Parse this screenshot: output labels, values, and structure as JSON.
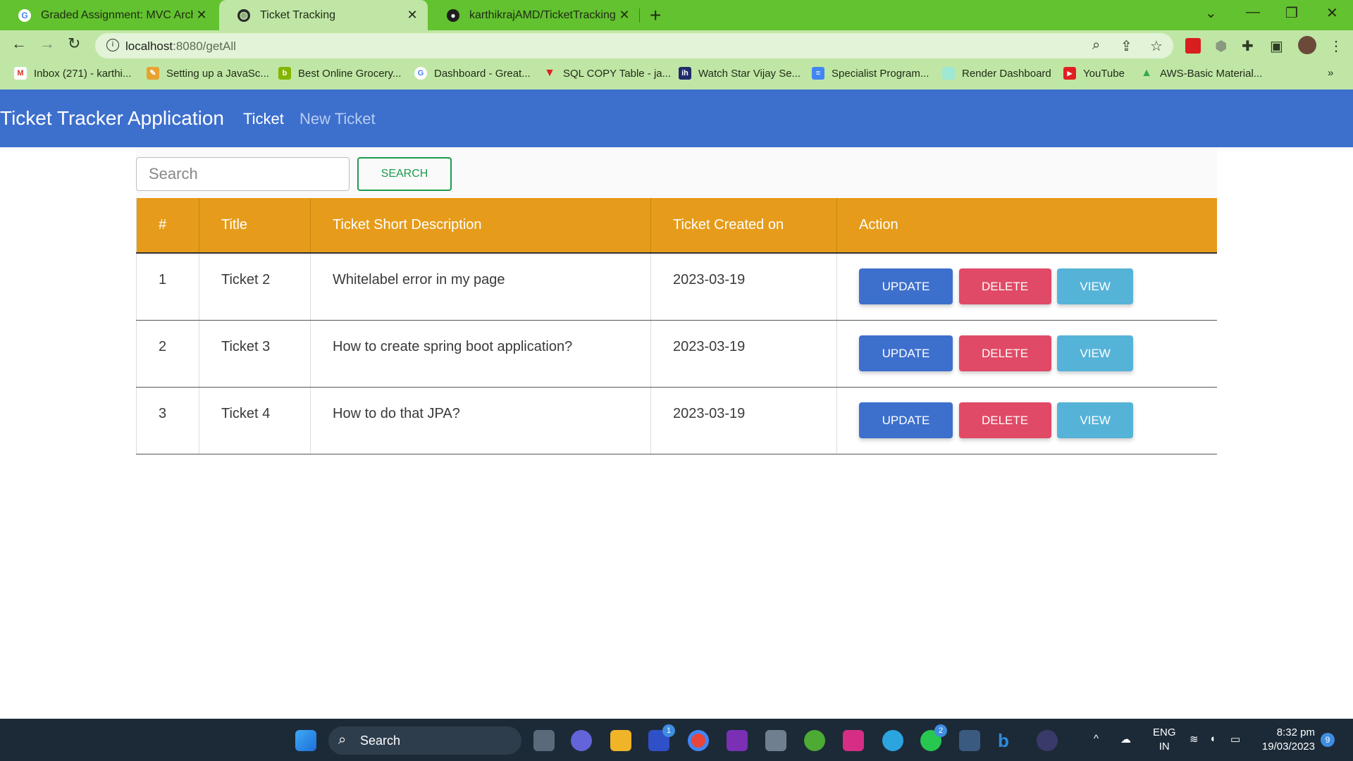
{
  "browser": {
    "tabs": [
      {
        "title": "Graded Assignment: MVC Archite",
        "icon": "google-icon",
        "active": false
      },
      {
        "title": "Ticket Tracking",
        "icon": "globe-icon",
        "active": true
      },
      {
        "title": "karthikrajAMD/TicketTracking",
        "icon": "github-icon",
        "active": false
      }
    ],
    "url_host": "localhost",
    "url_path": ":8080/getAll",
    "bookmarks": [
      {
        "label": "Inbox (271) - karthi...",
        "icon": "gmail-icon",
        "color": "#d93025"
      },
      {
        "label": "Setting up a JavaSc...",
        "icon": "pencil-icon",
        "color": "#e8a230"
      },
      {
        "label": "Best Online Grocery...",
        "icon": "bigbasket-icon",
        "color": "#84b500"
      },
      {
        "label": "Dashboard - Great...",
        "icon": "google-icon",
        "color": "#4285f4"
      },
      {
        "label": "SQL COPY Table - ja...",
        "icon": "javatpoint-icon",
        "color": "#e02020"
      },
      {
        "label": "Watch Star Vijay Se...",
        "icon": "hotstar-icon",
        "color": "#1f2b6b"
      },
      {
        "label": "Specialist Program...",
        "icon": "docs-icon",
        "color": "#4285f4"
      },
      {
        "label": "Render Dashboard",
        "icon": "render-icon",
        "color": "#9ee8d4"
      },
      {
        "label": "YouTube",
        "icon": "youtube-icon",
        "color": "#e02020"
      },
      {
        "label": "AWS-Basic Material...",
        "icon": "drive-icon",
        "color": "#34a853"
      }
    ]
  },
  "app": {
    "brand": "Ticket Tracker Application",
    "nav": {
      "ticket": "Ticket",
      "new_ticket": "New Ticket"
    },
    "search": {
      "placeholder": "Search",
      "button": "SEARCH"
    },
    "columns": [
      "#",
      "Title",
      "Ticket Short Description",
      "Ticket Created on",
      "Action"
    ],
    "rows": [
      {
        "id": "1",
        "title": "Ticket 2",
        "description": "Whitelabel error in my page",
        "created": "2023-03-19"
      },
      {
        "id": "2",
        "title": "Ticket 3",
        "description": "How to create spring boot application?",
        "created": "2023-03-19"
      },
      {
        "id": "3",
        "title": "Ticket 4",
        "description": "How to do that JPA?",
        "created": "2023-03-19"
      }
    ],
    "actions": {
      "update": "UPDATE",
      "delete": "DELETE",
      "view": "VIEW"
    },
    "colors": {
      "navbar": "#3d6fcd",
      "header": "#e69c1a",
      "update": "#3d6fcd",
      "delete": "#e04a66",
      "view": "#56b3d8",
      "search": "#1e9a4c"
    }
  },
  "taskbar": {
    "search": "Search",
    "lang1": "ENG",
    "lang2": "IN",
    "time": "8:32 pm",
    "date": "19/03/2023",
    "notifications": "9",
    "badge_outlook": "1",
    "badge_whatsapp": "2"
  }
}
